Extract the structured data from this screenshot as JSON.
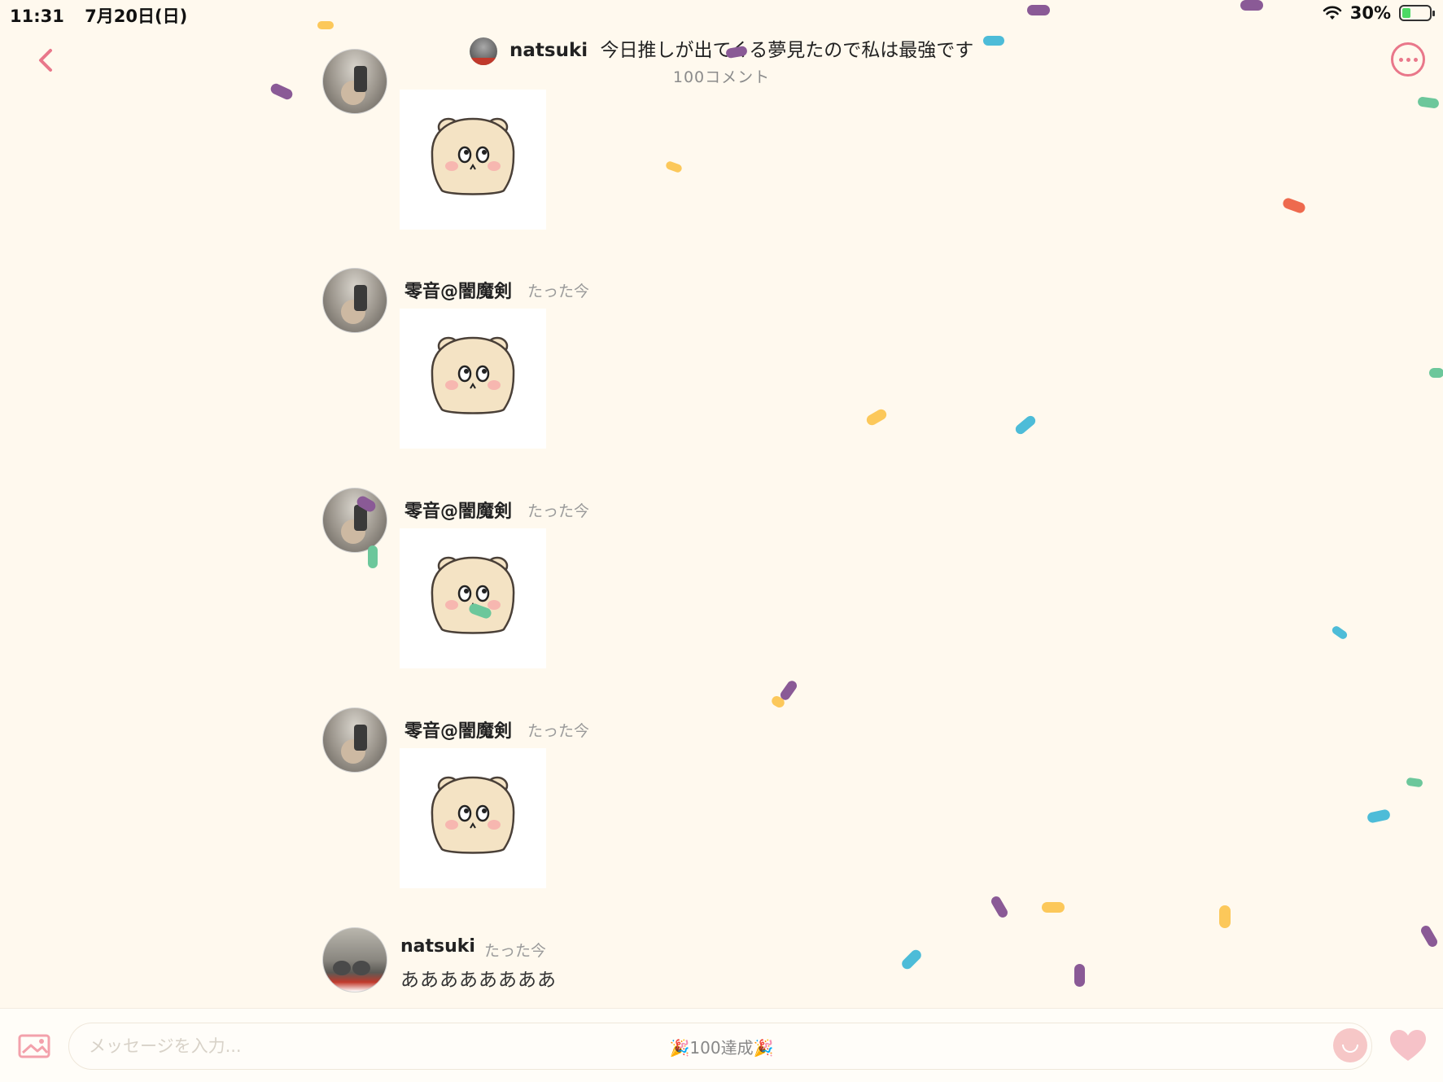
{
  "status_bar": {
    "time": "11:31",
    "date": "7月20日(日)",
    "battery": "30%"
  },
  "header": {
    "username": "natsuki",
    "title": "今日推しが出てくる夢見たので私は最強です",
    "comment_count": "100コメント"
  },
  "messages": [
    {
      "name": "零音@闇魔剣",
      "time": "たった今",
      "type": "sticker"
    },
    {
      "name": "零音@闇魔剣",
      "time": "たった今",
      "type": "sticker"
    },
    {
      "name": "零音@闇魔剣",
      "time": "たった今",
      "type": "sticker"
    },
    {
      "name": "natsuki",
      "time": "たった今",
      "type": "text",
      "text": "ああああああああ"
    }
  ],
  "input": {
    "placeholder": "メッセージを入力...",
    "achievement": "🎉100達成🎉"
  },
  "colors": {
    "accent": "#e9778a",
    "background": "#fff9ee",
    "confetti": [
      "#8a5a96",
      "#4dbcd8",
      "#fcc85a",
      "#6cc79b",
      "#ee6a4e"
    ]
  },
  "icons": [
    "back-icon",
    "more-icon",
    "image-icon",
    "face-icon",
    "heart-icon",
    "wifi-icon",
    "battery-icon"
  ]
}
